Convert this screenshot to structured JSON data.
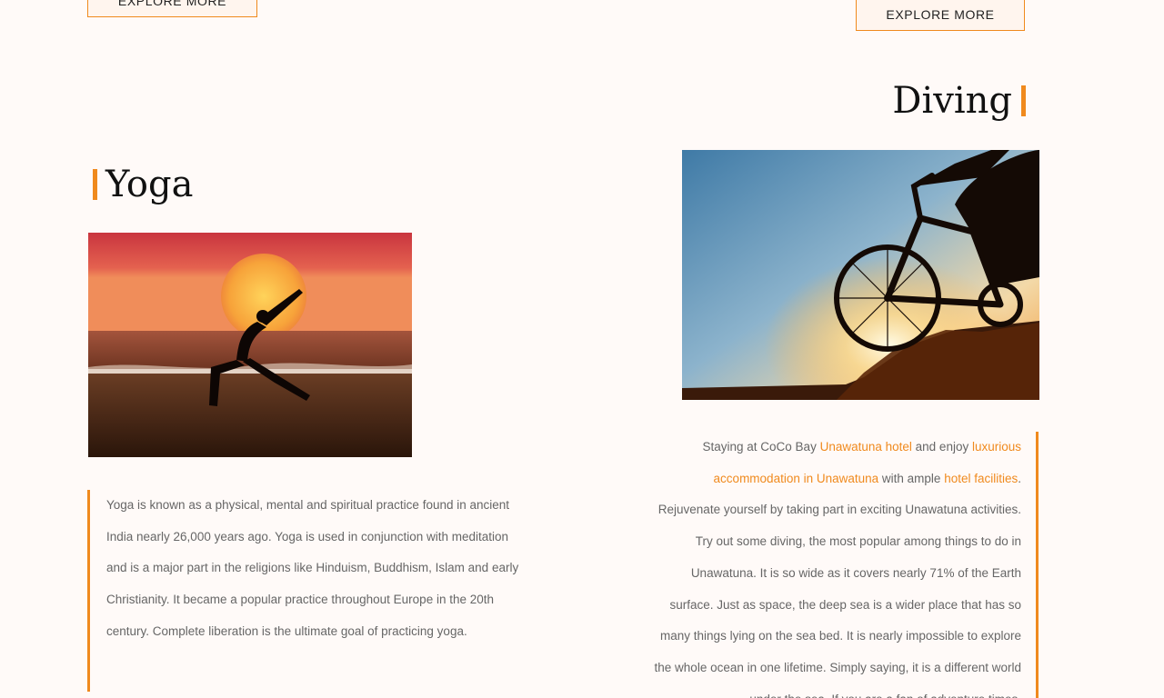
{
  "buttons": {
    "left_label": "EXPLORE MORE",
    "right_label": "EXPLORE MORE"
  },
  "yoga": {
    "title": "Yoga",
    "body": "Yoga is known as a physical, mental and spiritual practice found in ancient India nearly 26,000 years ago. Yoga is used in conjunction with meditation and is a major part in the religions like Hinduism, Buddhism, Islam and early Christianity. It became a popular practice throughout Europe in the 20th century. Complete liberation is the ultimate goal of practicing yoga."
  },
  "diving": {
    "title": "Diving",
    "p1": "Staying at CoCo Bay ",
    "link1": "Unawatuna hotel",
    "p2": " and enjoy ",
    "link2": "luxurious accommodation in Unawatuna",
    "p3": " with ample ",
    "link3": "hotel facilities",
    "p4": ". Rejuvenate yourself by taking part in exciting Unawatuna activities. Try out some diving, the most popular among things to do in Unawatuna. It is so wide as it covers nearly 71% of the Earth surface. Just as space, the deep sea is a wider place that has so many things lying on the sea bed. It is nearly impossible to explore the whole ocean in one lifetime. Simply saying, it is a different world under the sea. If you are a fan of adventure times,"
  },
  "colors": {
    "accent": "#f08a1e",
    "background": "#fffaf8",
    "heading": "#111111",
    "body_text": "#666666"
  }
}
